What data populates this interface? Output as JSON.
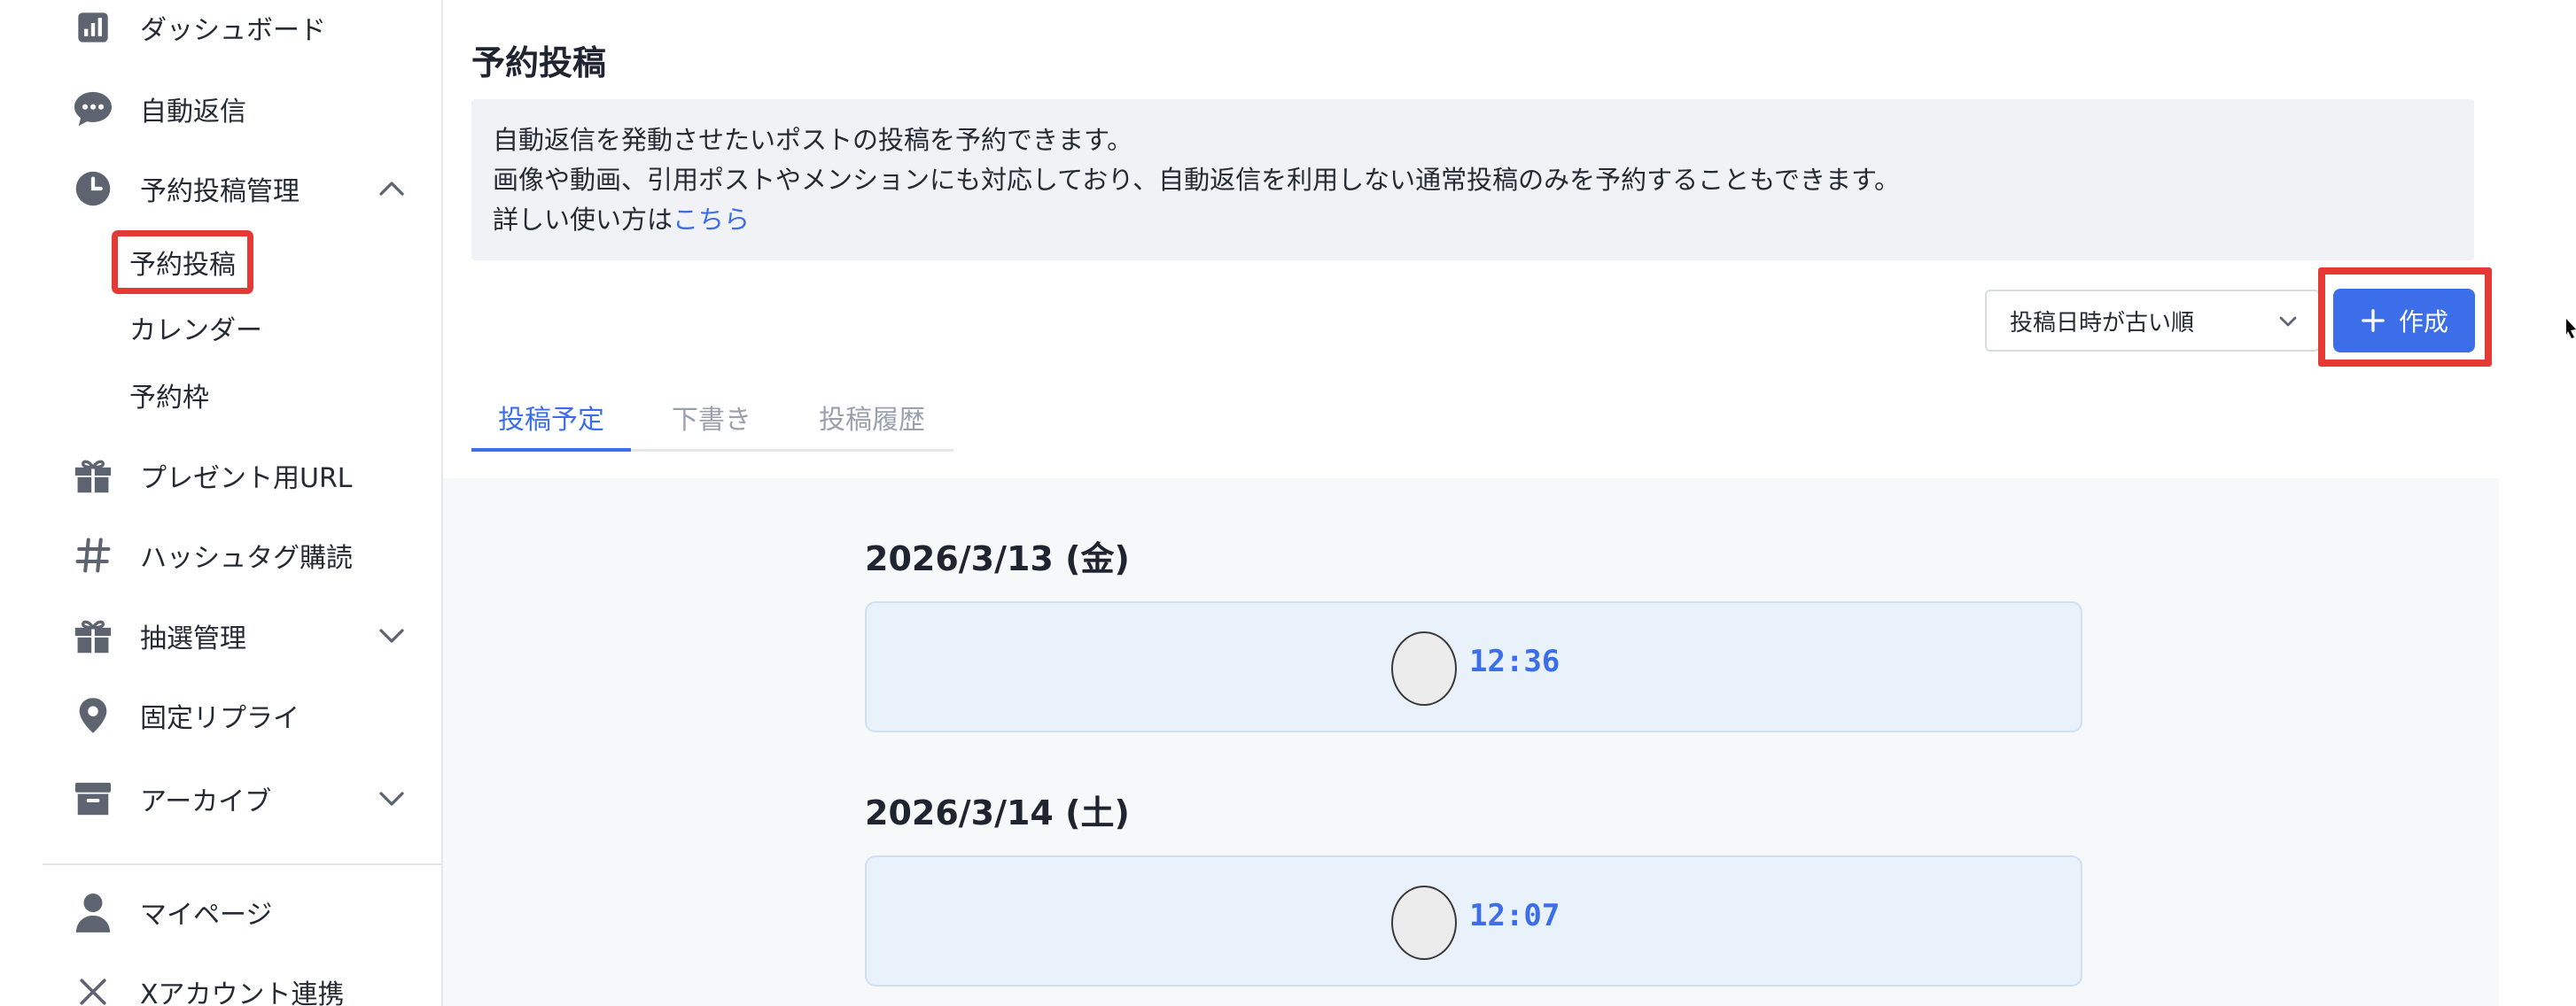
{
  "sidebar": {
    "items": [
      {
        "label": "ダッシュボード",
        "icon": "bar-chart-icon"
      },
      {
        "label": "自動返信",
        "icon": "chat-bubble-icon"
      },
      {
        "label": "予約投稿管理",
        "icon": "clock-icon",
        "expanded": true
      },
      {
        "label": "プレゼント用URL",
        "icon": "gift-icon"
      },
      {
        "label": "ハッシュタグ購読",
        "icon": "hashtag-icon"
      },
      {
        "label": "抽選管理",
        "icon": "gift-icon",
        "expanded": false
      },
      {
        "label": "固定リプライ",
        "icon": "map-pin-icon"
      },
      {
        "label": "アーカイブ",
        "icon": "archive-box-icon",
        "expanded": false
      },
      {
        "label": "マイページ",
        "icon": "user-icon"
      },
      {
        "label": "Xアカウント連携",
        "icon": "x-icon"
      }
    ],
    "sub_items": [
      {
        "label": "予約投稿",
        "active": true
      },
      {
        "label": "カレンダー",
        "active": false
      },
      {
        "label": "予約枠",
        "active": false
      }
    ]
  },
  "main": {
    "title": "予約投稿",
    "info": {
      "line1": "自動返信を発動させたいポストの投稿を予約できます。",
      "line2": "画像や動画、引用ポストやメンションにも対応しており、自動返信を利用しない通常投稿のみを予約することもできます。",
      "line3_prefix": "詳しい使い方は",
      "line3_link": "こちら"
    },
    "sort": {
      "selected": "投稿日時が古い順"
    },
    "create_label": "作成",
    "tabs": [
      {
        "label": "投稿予定",
        "active": true
      },
      {
        "label": "下書き",
        "active": false
      },
      {
        "label": "投稿履歴",
        "active": false
      }
    ],
    "groups": [
      {
        "date": "2026/3/13 (金)",
        "posts": [
          {
            "time": "12:36"
          }
        ]
      },
      {
        "date": "2026/3/14 (土)",
        "posts": [
          {
            "time": "12:07"
          }
        ]
      }
    ]
  },
  "colors": {
    "accent": "#3b6ee8",
    "highlight": "#e53935",
    "card_bg": "#e9f2fb"
  }
}
